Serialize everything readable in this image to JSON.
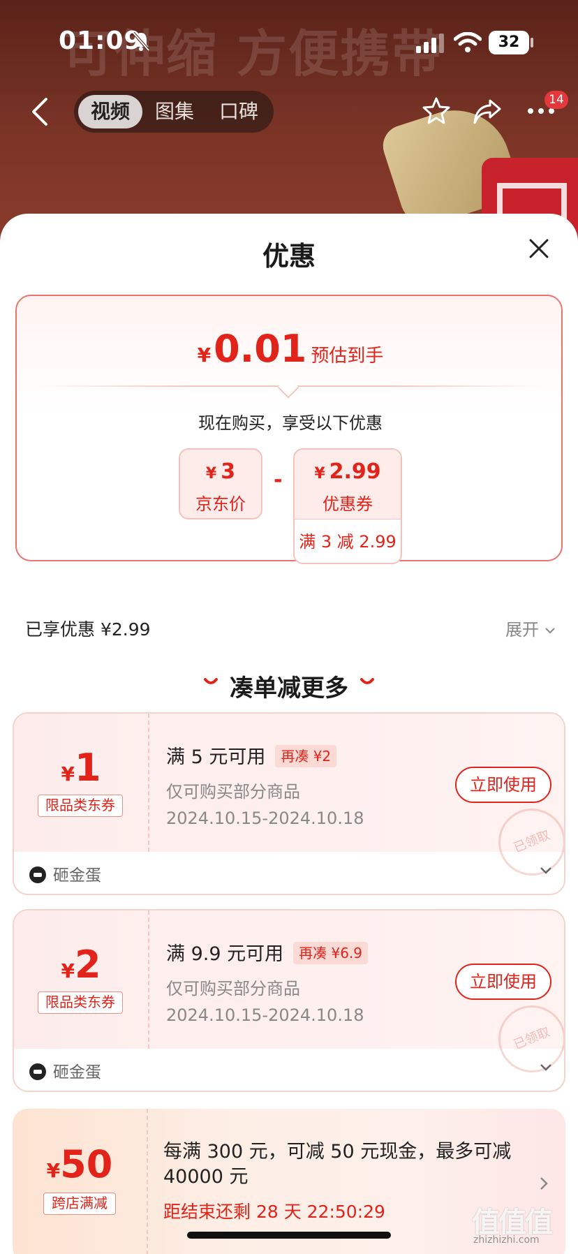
{
  "status_bar": {
    "time": "01:09",
    "battery": "32"
  },
  "background": {
    "watermark_text": "可伸缩 方便携带"
  },
  "nav": {
    "tabs": [
      {
        "label": "视频",
        "active": true
      },
      {
        "label": "图集",
        "active": false
      },
      {
        "label": "口碑",
        "active": false
      }
    ],
    "more_badge": "14"
  },
  "sheet": {
    "title": "优惠"
  },
  "summary": {
    "currency": "¥",
    "final_price": "0.01",
    "final_label": "预估到手",
    "enjoy_text": "现在购买，享受以下优惠",
    "jd_price": {
      "currency": "¥",
      "value": "3",
      "label": "京东价"
    },
    "minus": "-",
    "coupon": {
      "currency": "¥",
      "value": "2.99",
      "label": "优惠券",
      "rule": "满 3 减 2.99"
    }
  },
  "enjoyed": {
    "text": "已享优惠 ¥2.99",
    "expand_label": "展开"
  },
  "section": {
    "heading": "凑单减更多"
  },
  "coupons": [
    {
      "currency": "¥",
      "value": "1",
      "tag": "限品类东券",
      "condition": "满 5 元可用",
      "extra": "再凑 ¥2",
      "scope": "仅可购买部分商品",
      "date": "2024.10.15-2024.10.18",
      "button": "立即使用",
      "stamp": "已领取",
      "source": "砸金蛋"
    },
    {
      "currency": "¥",
      "value": "2",
      "tag": "限品类东券",
      "condition": "满 9.9 元可用",
      "extra": "再凑 ¥6.9",
      "scope": "仅可购买部分商品",
      "date": "2024.10.15-2024.10.18",
      "button": "立即使用",
      "stamp": "已领取",
      "source": "砸金蛋"
    }
  ],
  "promo": {
    "currency": "¥",
    "value": "50",
    "tag": "跨店满减",
    "description": "每满 300 元，可减 50 元现金，最多可减 40000 元",
    "countdown": "距结束还剩 28 天 22:50:29"
  },
  "watermark": {
    "mark": "值值值",
    "url": "zhizhizhi.com"
  },
  "colors": {
    "accent": "#e2231a",
    "card_border": "#e9746d",
    "coupon_bg": "#fdeceb"
  }
}
